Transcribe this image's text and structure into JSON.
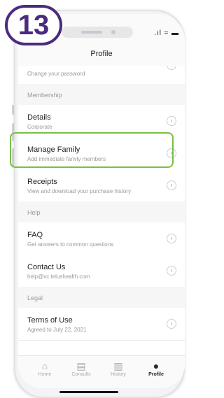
{
  "step_badge": "13",
  "status": {
    "icons": ".ıl ≈ ▬"
  },
  "header": {
    "title": "Profile"
  },
  "rows_top": [
    {
      "subtitle": "Change your password"
    }
  ],
  "sections": {
    "membership": "Membership",
    "help": "Help",
    "legal": "Legal"
  },
  "membership_items": [
    {
      "title": "Details",
      "subtitle": "Corporate"
    },
    {
      "title": "Manage Family",
      "subtitle": "Add immediate family members"
    },
    {
      "title": "Receipts",
      "subtitle": "View and download your purchase history"
    }
  ],
  "help_items": [
    {
      "title": "FAQ",
      "subtitle": "Get answers to common questions"
    },
    {
      "title": "Contact Us",
      "subtitle": "help@vc.telushealth.com"
    }
  ],
  "legal_items": [
    {
      "title": "Terms of Use",
      "subtitle": "Agreed to July 22, 2021"
    }
  ],
  "chevron": "›",
  "tabs": [
    {
      "label": "Home",
      "icon": "home-icon",
      "glyph": "⌂"
    },
    {
      "label": "Consults",
      "icon": "chat-icon",
      "glyph": "▤"
    },
    {
      "label": "History",
      "icon": "document-icon",
      "glyph": "▥"
    },
    {
      "label": "Profile",
      "icon": "person-icon",
      "glyph": "●"
    }
  ],
  "colors": {
    "highlight": "#77c043",
    "badge": "#4b2b7e"
  }
}
